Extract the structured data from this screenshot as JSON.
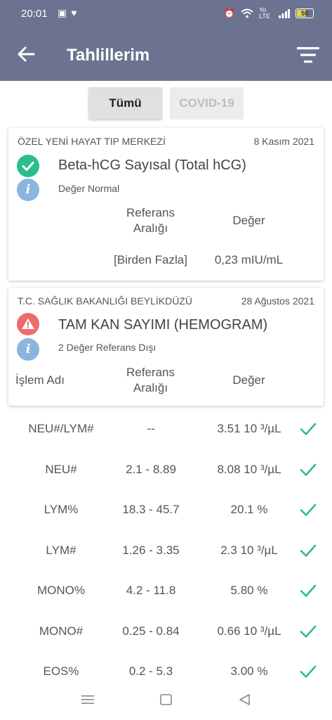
{
  "status_bar": {
    "time": "20:01",
    "right_text": "Yo LTE",
    "battery_level": "50",
    "icons": [
      "cube-icon",
      "heart-365-icon",
      "alarm-icon",
      "wifi-icon",
      "lte-icon",
      "signal-icon",
      "battery-icon"
    ]
  },
  "app_bar": {
    "title": "Tahlillerim",
    "bg_color": "#6b7390"
  },
  "tabs": [
    {
      "label": "Tümü",
      "active": true
    },
    {
      "label": "COVID-19",
      "active": false
    }
  ],
  "cards": [
    {
      "institution": "ÖZEL YENİ HAYAT TIP MERKEZİ",
      "date": "8 Kasım 2021",
      "test_name": "Beta-hCG Sayısal (Total hCG)",
      "status": "normal",
      "status_color": "#2bbd8e",
      "note": "Değer Normal",
      "col_ref_header_1": "Referans",
      "col_ref_header_2": "Aralığı",
      "col_value_header": "Değer",
      "ref_value": "[Birden Fazla]",
      "value": "0,23 mIU/mL"
    },
    {
      "institution": "T.C. SAĞLIK BAKANLIĞI BEYLİKDÜZÜ",
      "date": "28 Ağustos 2021",
      "test_name": "TAM KAN SAYIMI (HEMOGRAM)",
      "status": "warning",
      "status_color": "#ef6b6b",
      "note": "2 Değer Referans Dışı",
      "col_name_header": "İşlem Adı",
      "col_ref_header_1": "Referans",
      "col_ref_header_2": "Aralığı",
      "col_value_header": "Değer"
    }
  ],
  "results": [
    {
      "name": "NEU#/LYM#",
      "ref": "--",
      "value": "3.51 10 ³/µL"
    },
    {
      "name": "NEU#",
      "ref": "2.1 - 8.89",
      "value": "8.08 10 ³/µL"
    },
    {
      "name": "LYM%",
      "ref": "18.3 - 45.7",
      "value": "20.1 %"
    },
    {
      "name": "LYM#",
      "ref": "1.26 - 3.35",
      "value": "2.3 10 ³/µL"
    },
    {
      "name": "MONO%",
      "ref": "4.2 - 11.8",
      "value": "5.80 %"
    },
    {
      "name": "MONO#",
      "ref": "0.25 - 0.84",
      "value": "0.66 10 ³/µL"
    },
    {
      "name": "EOS%",
      "ref": "0.2 - 5.3",
      "value": "3.00 %"
    }
  ],
  "check_color": "#2bbd8e"
}
